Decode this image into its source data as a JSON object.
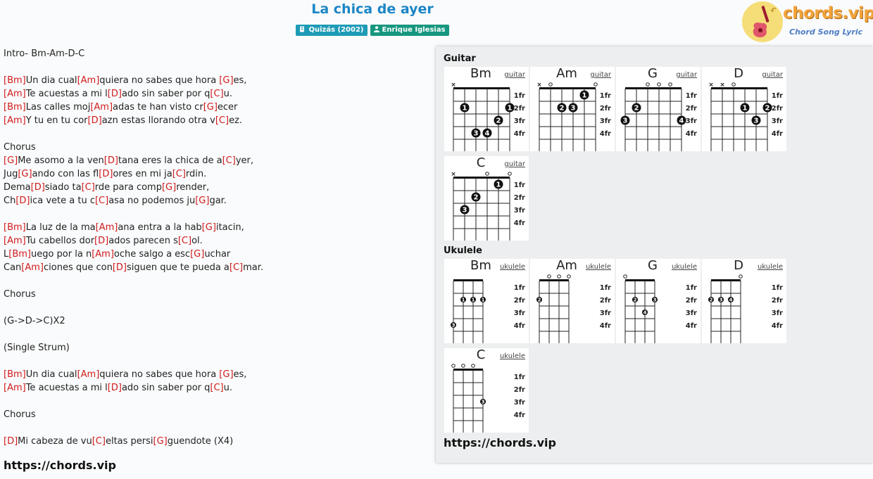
{
  "header": {
    "title": "La chica de ayer",
    "album": "Quizás (2002)",
    "artist": "Enrique Iglesias"
  },
  "logo": {
    "text": "chords.vip",
    "subtitle": "Chord Song Lyric"
  },
  "lyrics": [
    [
      {
        "t": "Intro- Bm-Am-D-C"
      }
    ],
    [],
    [
      {
        "c": "[Bm]"
      },
      {
        "t": "Un dia cual"
      },
      {
        "c": "[Am]"
      },
      {
        "t": "quiera no sabes que hora "
      },
      {
        "c": "[G]"
      },
      {
        "t": "es,"
      }
    ],
    [
      {
        "c": "[Am]"
      },
      {
        "t": "Te acuestas a mi l"
      },
      {
        "c": "[D]"
      },
      {
        "t": "ado sin saber por q"
      },
      {
        "c": "[C]"
      },
      {
        "t": "u."
      }
    ],
    [
      {
        "c": "[Bm]"
      },
      {
        "t": "Las calles moj"
      },
      {
        "c": "[Am]"
      },
      {
        "t": "adas te han visto cr"
      },
      {
        "c": "[G]"
      },
      {
        "t": "ecer"
      }
    ],
    [
      {
        "c": "[Am]"
      },
      {
        "t": "Y tu en tu cor"
      },
      {
        "c": "[D]"
      },
      {
        "t": "azn estas llorando otra v"
      },
      {
        "c": "[C]"
      },
      {
        "t": "ez."
      }
    ],
    [],
    [
      {
        "t": "Chorus"
      }
    ],
    [
      {
        "c": "[G]"
      },
      {
        "t": "Me asomo a la ven"
      },
      {
        "c": "[D]"
      },
      {
        "t": "tana eres la chica de a"
      },
      {
        "c": "[C]"
      },
      {
        "t": "yer,"
      }
    ],
    [
      {
        "t": "Jug"
      },
      {
        "c": "[G]"
      },
      {
        "t": "ando con las fl"
      },
      {
        "c": "[D]"
      },
      {
        "t": "ores en mi ja"
      },
      {
        "c": "[C]"
      },
      {
        "t": "rdin."
      }
    ],
    [
      {
        "t": "Dema"
      },
      {
        "c": "[D]"
      },
      {
        "t": "siado ta"
      },
      {
        "c": "[C]"
      },
      {
        "t": "rde para comp"
      },
      {
        "c": "[G]"
      },
      {
        "t": "render,"
      }
    ],
    [
      {
        "t": "Ch"
      },
      {
        "c": "[D]"
      },
      {
        "t": "ica vete a tu c"
      },
      {
        "c": "[C]"
      },
      {
        "t": "asa no podemos ju"
      },
      {
        "c": "[G]"
      },
      {
        "t": "gar."
      }
    ],
    [],
    [
      {
        "c": "[Bm]"
      },
      {
        "t": "La luz de la ma"
      },
      {
        "c": "[Am]"
      },
      {
        "t": "ana entra a la hab"
      },
      {
        "c": "[G]"
      },
      {
        "t": "itacin,"
      }
    ],
    [
      {
        "c": "[Am]"
      },
      {
        "t": "Tu cabellos dor"
      },
      {
        "c": "[D]"
      },
      {
        "t": "ados parecen s"
      },
      {
        "c": "[C]"
      },
      {
        "t": "ol."
      }
    ],
    [
      {
        "t": "L"
      },
      {
        "c": "[Bm]"
      },
      {
        "t": "uego por la n"
      },
      {
        "c": "[Am]"
      },
      {
        "t": "oche salgo a esc"
      },
      {
        "c": "[G]"
      },
      {
        "t": "uchar"
      }
    ],
    [
      {
        "t": "Can"
      },
      {
        "c": "[Am]"
      },
      {
        "t": "ciones que con"
      },
      {
        "c": "[D]"
      },
      {
        "t": "siguen que te pueda a"
      },
      {
        "c": "[C]"
      },
      {
        "t": "mar."
      }
    ],
    [],
    [
      {
        "t": "Chorus"
      }
    ],
    [],
    [
      {
        "t": "(G->D->C)X2"
      }
    ],
    [],
    [
      {
        "t": "(Single Strum)"
      }
    ],
    [],
    [
      {
        "c": "[Bm]"
      },
      {
        "t": "Un dia cual"
      },
      {
        "c": "[Am]"
      },
      {
        "t": "quiera no sabes que hora "
      },
      {
        "c": "[G]"
      },
      {
        "t": "es,"
      }
    ],
    [
      {
        "c": "[Am]"
      },
      {
        "t": "Te acuestas a mi l"
      },
      {
        "c": "[D]"
      },
      {
        "t": "ado sin saber por q"
      },
      {
        "c": "[C]"
      },
      {
        "t": "u."
      }
    ],
    [],
    [
      {
        "t": "Chorus"
      }
    ],
    [],
    [
      {
        "c": "[D]"
      },
      {
        "t": "Mi cabeza de vu"
      },
      {
        "c": "[C]"
      },
      {
        "t": "eltas persi"
      },
      {
        "c": "[G]"
      },
      {
        "t": "guendote (X4)"
      }
    ]
  ],
  "lyrics_footer": "https://chords.vip",
  "panel": {
    "guitar_title": "Guitar",
    "ukulele_title": "Ukulele",
    "footer": "https://chords.vip",
    "fret_labels": [
      "1fr",
      "2fr",
      "3fr",
      "4fr"
    ],
    "guitar": [
      {
        "name": "Bm",
        "link": "guitar",
        "open": [],
        "muted": [
          0
        ],
        "dots": [
          {
            "s": 1,
            "f": 2,
            "n": "1"
          },
          {
            "s": 5,
            "f": 2,
            "n": "1"
          },
          {
            "s": 4,
            "f": 3,
            "n": "2"
          },
          {
            "s": 2,
            "f": 4,
            "n": "3"
          },
          {
            "s": 3,
            "f": 4,
            "n": "4"
          }
        ]
      },
      {
        "name": "Am",
        "link": "guitar",
        "open": [
          1,
          5
        ],
        "muted": [
          0
        ],
        "dots": [
          {
            "s": 4,
            "f": 1,
            "n": "1"
          },
          {
            "s": 2,
            "f": 2,
            "n": "2"
          },
          {
            "s": 3,
            "f": 2,
            "n": "3"
          }
        ]
      },
      {
        "name": "G",
        "link": "guitar",
        "open": [
          2,
          3,
          4
        ],
        "muted": [],
        "dots": [
          {
            "s": 1,
            "f": 2,
            "n": "2"
          },
          {
            "s": 0,
            "f": 3,
            "n": "3"
          },
          {
            "s": 5,
            "f": 3,
            "n": "4"
          }
        ]
      },
      {
        "name": "D",
        "link": "guitar",
        "open": [
          2
        ],
        "muted": [
          0,
          1
        ],
        "dots": [
          {
            "s": 3,
            "f": 2,
            "n": "1"
          },
          {
            "s": 5,
            "f": 2,
            "n": "2"
          },
          {
            "s": 4,
            "f": 3,
            "n": "3"
          }
        ]
      },
      {
        "name": "C",
        "link": "guitar",
        "open": [
          3,
          5
        ],
        "muted": [
          0
        ],
        "dots": [
          {
            "s": 4,
            "f": 1,
            "n": "1"
          },
          {
            "s": 2,
            "f": 2,
            "n": "2"
          },
          {
            "s": 1,
            "f": 3,
            "n": "3"
          }
        ]
      }
    ],
    "ukulele": [
      {
        "name": "Bm",
        "link": "ukulele",
        "open": [],
        "muted": [],
        "dots": [
          {
            "s": 1,
            "f": 2,
            "n": "1"
          },
          {
            "s": 2,
            "f": 2,
            "n": "1"
          },
          {
            "s": 3,
            "f": 2,
            "n": "1"
          },
          {
            "s": 0,
            "f": 4,
            "n": "3"
          }
        ]
      },
      {
        "name": "Am",
        "link": "ukulele",
        "open": [
          1,
          2,
          3
        ],
        "muted": [],
        "dots": [
          {
            "s": 0,
            "f": 2,
            "n": "2"
          }
        ]
      },
      {
        "name": "G",
        "link": "ukulele",
        "open": [
          0
        ],
        "muted": [],
        "dots": [
          {
            "s": 1,
            "f": 2,
            "n": "2"
          },
          {
            "s": 3,
            "f": 2,
            "n": "3"
          },
          {
            "s": 2,
            "f": 3,
            "n": "4"
          }
        ]
      },
      {
        "name": "D",
        "link": "ukulele",
        "open": [
          3
        ],
        "muted": [],
        "dots": [
          {
            "s": 0,
            "f": 2,
            "n": "2"
          },
          {
            "s": 1,
            "f": 2,
            "n": "3"
          },
          {
            "s": 2,
            "f": 2,
            "n": "4"
          }
        ]
      },
      {
        "name": "C",
        "link": "ukulele",
        "open": [
          0,
          1,
          2
        ],
        "muted": [],
        "dots": [
          {
            "s": 3,
            "f": 3,
            "n": "3"
          }
        ]
      }
    ]
  }
}
